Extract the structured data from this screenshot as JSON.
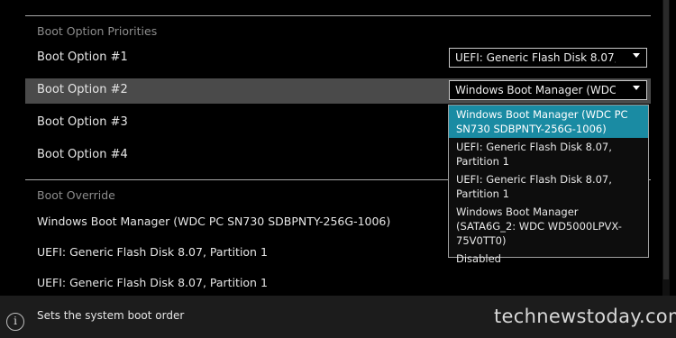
{
  "boot_priorities": {
    "section_title": "Boot Option Priorities",
    "options": [
      {
        "label": "Boot Option #1",
        "value": "UEFI: Generic Flash Disk 8.07, P"
      },
      {
        "label": "Boot Option #2",
        "value": "Windows Boot Manager (WDC PC"
      },
      {
        "label": "Boot Option #3"
      },
      {
        "label": "Boot Option #4"
      }
    ]
  },
  "dropdown": {
    "items": [
      "Windows Boot Manager (WDC PC SN730 SDBPNTY-256G-1006)",
      "UEFI: Generic Flash Disk 8.07, Partition 1",
      "UEFI: Generic Flash Disk 8.07, Partition 1",
      "Windows Boot Manager (SATA6G_2: WDC WD5000LPVX-75V0TT0)",
      "Disabled"
    ]
  },
  "boot_override": {
    "section_title": "Boot Override",
    "items": [
      "Windows Boot Manager (WDC PC SN730 SDBPNTY-256G-1006)",
      "UEFI: Generic Flash Disk 8.07, Partition 1",
      "UEFI: Generic Flash Disk 8.07, Partition 1"
    ]
  },
  "footer": {
    "info_icon": "i",
    "help_text": "Sets the system boot order",
    "watermark": "technewstoday.com"
  },
  "colors": {
    "background": "#000000",
    "selected_row": "#4a4a4a",
    "dropdown_highlight": "#1a8ba3",
    "footer": "#1c1c1c"
  }
}
